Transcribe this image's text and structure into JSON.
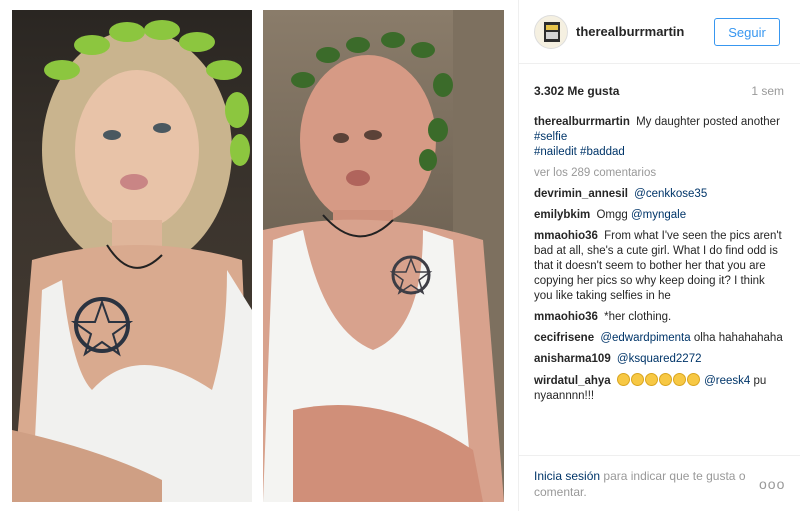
{
  "post": {
    "username": "therealburrmartin",
    "follow_label": "Seguir",
    "likes": "3.302 Me gusta",
    "time": "1 sem"
  },
  "caption": {
    "user": "therealburrmartin",
    "text": "My daughter posted another",
    "tag1": "#selfie",
    "tag2": "#nailedit",
    "tag3": "#baddad"
  },
  "view_all": "ver los 289 comentarios",
  "comments": [
    {
      "user": "devrimin_annesil",
      "link": "@cenkkose35",
      "text": ""
    },
    {
      "user": "emilybkim",
      "text": "Omgg",
      "link": "@myngale"
    },
    {
      "user": "mmaohio36",
      "text": "From what I've seen the pics aren't bad at all, she's a cute girl. What I do find odd is that it doesn't seem to bother her that you are copying her pics so why keep doing it? I think you like taking selfies in he",
      "link": ""
    },
    {
      "user": "mmaohio36",
      "text": "*her clothing.",
      "link": ""
    },
    {
      "user": "cecifrisene",
      "link": "@edwardpimenta",
      "text": "olha hahahahaha"
    },
    {
      "user": "anisharma109",
      "link": "@ksquared2272",
      "text": ""
    },
    {
      "user": "wirdatul_ahya",
      "link": "@reesk4",
      "text": "pu nyaannnn!!!"
    }
  ],
  "footer": {
    "login_link": "Inicia sesión",
    "login_text": "para indicar que te gusta o comentar.",
    "more": "ooo"
  }
}
